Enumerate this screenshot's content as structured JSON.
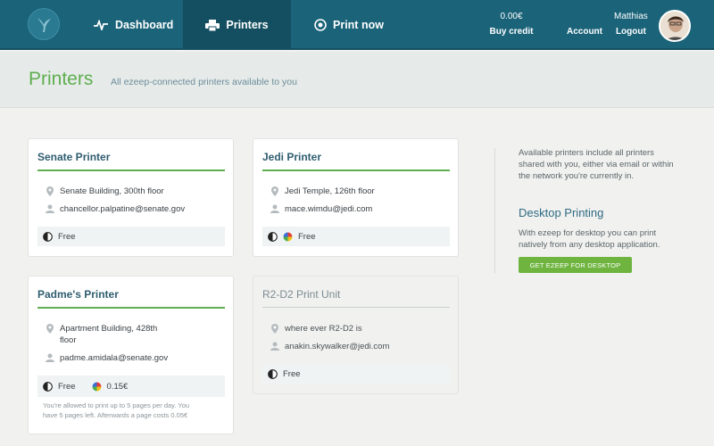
{
  "nav": {
    "dashboard": "Dashboard",
    "printers": "Printers",
    "print_now": "Print now",
    "credit_amount": "0.00€",
    "buy_credit": "Buy credit",
    "account": "Account",
    "user_name": "Matthias",
    "logout": "Logout"
  },
  "header": {
    "title": "Printers",
    "subtitle": "All ezeep-connected printers available to you"
  },
  "printers": [
    {
      "name": "Senate Printer",
      "location": "Senate Building, 300th floor",
      "email": "chancellor.palpatine@senate.gov",
      "bw_price": "Free",
      "status": "online"
    },
    {
      "name": "Jedi Printer",
      "location": "Jedi Temple, 126th floor",
      "email": "mace.wimdu@jedi.com",
      "bw_price": "Free",
      "status": "online"
    },
    {
      "name": "Padme's Printer",
      "location_line1": "Apartment Building, 428th",
      "location_line2": "floor",
      "email": "padme.amidala@senate.gov",
      "bw_price": "Free",
      "color_price": "0.15€",
      "note_line1": "You're allowed to print up to 5 pages per day. You",
      "note_line2": "have 5 pages left. Afterwards a page costs 0.05€",
      "status": "online"
    },
    {
      "name": "R2-D2 Print Unit",
      "location": "where ever R2-D2 is",
      "email": "anakin.skywalker@jedi.com",
      "bw_price": "Free",
      "status": "offline"
    }
  ],
  "sidebar": {
    "info_line1": "Available printers include all printers",
    "info_line2": "shared with you, either via email or within",
    "info_line3": "the network you're currently in.",
    "desktop_title": "Desktop Printing",
    "desktop_line1": "With ezeep for desktop you can print",
    "desktop_line2": "natively from any desktop application.",
    "desktop_button": "GET EZEEP FOR DESKTOP"
  },
  "colors": {
    "nav_bg": "#1a6379",
    "accent_green": "#5fae4f",
    "title_blue": "#2f5d70"
  }
}
